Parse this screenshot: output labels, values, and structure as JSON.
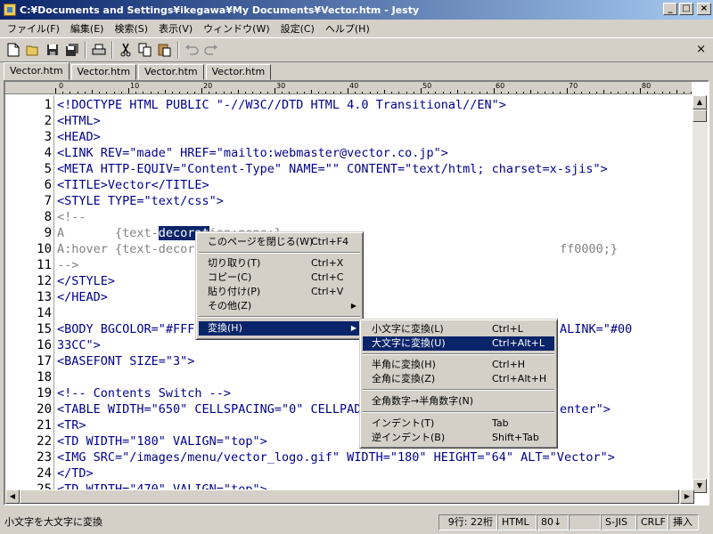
{
  "window": {
    "title": "C:¥Documents and Settings¥ikegawa¥My Documents¥Vector.htm - Jesty",
    "minimize": "_",
    "maximize": "□",
    "close": "×"
  },
  "menubar": [
    "ファイル(F)",
    "編集(E)",
    "検索(S)",
    "表示(V)",
    "ウィンドウ(W)",
    "設定(C)",
    "ヘルプ(H)"
  ],
  "toolbar": {
    "icons": [
      "new-file-icon",
      "open-folder-icon",
      "save-icon",
      "save-all-icon",
      "print-icon",
      "cut-icon",
      "copy-icon",
      "paste-icon",
      "undo-icon",
      "redo-icon"
    ],
    "close_glyph": "×"
  },
  "tabs": [
    "Vector.htm",
    "Vector.htm",
    "Vector.htm",
    "Vector.htm"
  ],
  "ruler": [
    "0",
    "10",
    "20",
    "30",
    "40",
    "50",
    "60",
    "70",
    "80"
  ],
  "line_numbers": [
    "1",
    "2",
    "3",
    "4",
    "5",
    "6",
    "7",
    "8",
    "9",
    "10",
    "11",
    "12",
    "13",
    "14",
    "15",
    "16",
    "17",
    "18",
    "19",
    "20",
    "21",
    "22",
    "23",
    "24",
    "25"
  ],
  "code": [
    "<!DOCTYPE HTML PUBLIC \"-//W3C//DTD HTML 4.0 Transitional//EN\">",
    "<HTML>",
    "<HEAD>",
    "<LINK REV=\"made\" HREF=\"mailto:webmaster@vector.co.jp\">",
    "<META HTTP-EQUIV=\"Content-Type\" NAME=\"\" CONTENT=\"text/html; charset=x-sjis\">",
    "<TITLE>Vector</TITLE>",
    "<STYLE TYPE=\"text/css\">",
    "<!--",
    "",
    "A:hover {text-decor",
    "-->",
    "</STYLE>",
    "</HEAD>",
    "",
    "<BODY BGCOLOR=\"#FFF",
    "33CC\">",
    "<BASEFONT SIZE=\"3\">",
    "",
    "<!-- Contents Switch -->",
    "<TABLE WIDTH=\"650\" CELLSPACING=\"0\" CELLPAD",
    "<TR>",
    "<TD WIDTH=\"180\" VALIGN=\"top\">",
    "<IMG SRC=\"/images/menu/vector_logo.gif\" WIDTH=\"180\" HEIGHT=\"64\" ALT=\"Vector\">",
    "</TD>",
    "<TD WIDTH=\"470\" VALIGN=\"top\">"
  ],
  "line9": {
    "before": "A       {text-",
    "selected": "decorat",
    "after": "ion:none;}"
  },
  "line10_tail": "ff0000;}",
  "line15_tail": "ALINK=\"#00",
  "line20_tail": "enter\">",
  "context_menu": {
    "items": [
      {
        "label": "このページを閉じる(W)",
        "shortcut": "Ctrl+F4"
      },
      {
        "label": "切り取り(T)",
        "shortcut": "Ctrl+X"
      },
      {
        "label": "コピー(C)",
        "shortcut": "Ctrl+C"
      },
      {
        "label": "貼り付け(P)",
        "shortcut": "Ctrl+V"
      },
      {
        "label": "その他(Z)",
        "shortcut": ""
      },
      {
        "label": "変換(H)",
        "shortcut": ""
      }
    ]
  },
  "submenu": {
    "items": [
      {
        "label": "小文字に変換(L)",
        "shortcut": "Ctrl+L"
      },
      {
        "label": "大文字に変換(U)",
        "shortcut": "Ctrl+Alt+L"
      },
      {
        "label": "半角に変換(H)",
        "shortcut": "Ctrl+H"
      },
      {
        "label": "全角に変換(Z)",
        "shortcut": "Ctrl+Alt+H"
      },
      {
        "label": "全角数字→半角数字(N)",
        "shortcut": ""
      },
      {
        "label": "インデント(T)",
        "shortcut": "Tab"
      },
      {
        "label": "逆インデント(B)",
        "shortcut": "Shift+Tab"
      }
    ]
  },
  "status": {
    "message": "小文字を大文字に変換",
    "position": "9行: 22桁",
    "mode": "HTML",
    "width": "80↓",
    "encoding": "S-JIS",
    "newline": "CRLF",
    "insert": "挿入"
  }
}
